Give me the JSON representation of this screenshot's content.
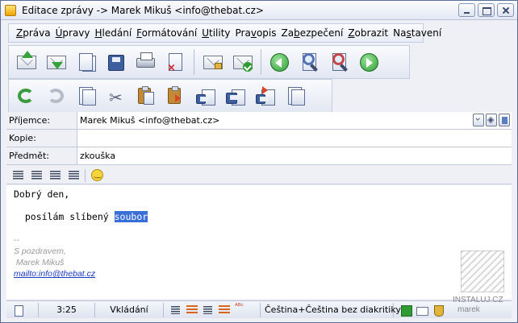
{
  "window": {
    "title": "Editace zprávy -> Marek Mikuš <info@thebat.cz>"
  },
  "menu": [
    {
      "pre": "",
      "u": "Z",
      "post": "práva"
    },
    {
      "pre": "",
      "u": "Ú",
      "post": "pravy"
    },
    {
      "pre": "",
      "u": "H",
      "post": "ledání"
    },
    {
      "pre": "",
      "u": "F",
      "post": "ormátování"
    },
    {
      "pre": "",
      "u": "U",
      "post": "tility"
    },
    {
      "pre": "Pra",
      "u": "v",
      "post": "opis"
    },
    {
      "pre": "Za",
      "u": "b",
      "post": "ezpečení"
    },
    {
      "pre": "",
      "u": "Z",
      "post": "obrazit"
    },
    {
      "pre": "Na",
      "u": "s",
      "post": "tavení"
    }
  ],
  "fields": {
    "to_label": "Příjemce:",
    "to_value": "Marek Mikuš <info@thebat.cz>",
    "cc_label": "Kopie:",
    "cc_value": "",
    "subject_label": "Předmět:",
    "subject_value": "zkouška"
  },
  "body": {
    "greeting": "Dobrý den,",
    "line2_before": "  posílám slíbený ",
    "line2_selected": "soubor",
    "sig_dashes": "--",
    "sig_regards": "S pozdravem,",
    "sig_name": " Marek Mikuš",
    "sig_link": "mailto:info@thebat.cz"
  },
  "status": {
    "cursor": "3:25",
    "mode": "Vkládání",
    "language": "Čeština+Čeština bez diakritiky"
  },
  "watermark": {
    "site": "INSTALUJ.CZ",
    "author": "marek"
  },
  "colors": {
    "selection": "#3a6fd8",
    "accent": "#5a6e9a"
  }
}
